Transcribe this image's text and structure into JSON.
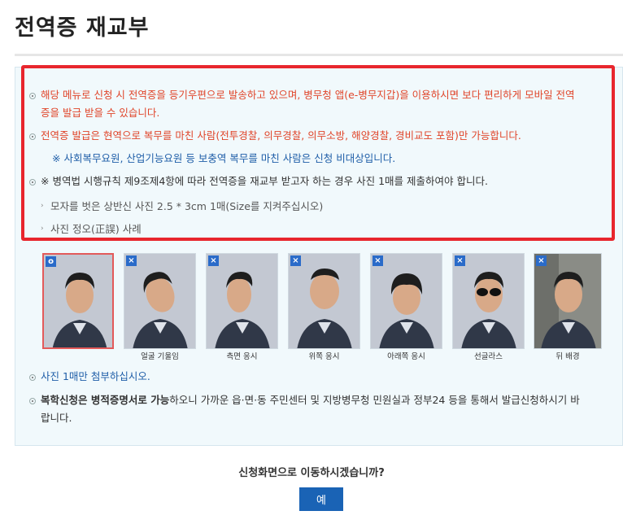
{
  "page": {
    "title": "전역증 재교부"
  },
  "notice": {
    "line1a": "해당 메뉴로 신청 시 전역증을 등기우편으로 발송하고 있으며, 병무청 앱(e-병무지갑)을 이용하시면 보다 편리하게 모바일 전역",
    "line1b": "증을 발급 받을 수 있습니다.",
    "line2": "전역증 발급은 현역으로 복무를 마친 사람(전투경찰, 의무경찰, 의무소방, 해양경찰, 경비교도 포함)만 가능합니다.",
    "line3": "※ 사회복무요원, 산업기능요원 등 보충역 복무를 마친 사람은 신청 비대상입니다.",
    "line4": "※ 병역법 시행규칙 제9조제4항에 따라 전역증을 재교부 받고자 하는 경우 사진 1매를 제출하여야 합니다.",
    "line5": "모자를 벗은 상반신 사진 2.5 * 3cm 1매(Size를 지켜주십시오)",
    "line6": "사진 정오(正誤) 사례"
  },
  "photos": [
    {
      "badge": "o",
      "caption": ""
    },
    {
      "badge": "×",
      "caption": "얼굴 기울임"
    },
    {
      "badge": "×",
      "caption": "측면 응시"
    },
    {
      "badge": "×",
      "caption": "위쪽 응시"
    },
    {
      "badge": "×",
      "caption": "아래쪽 응시"
    },
    {
      "badge": "×",
      "caption": "선글라스"
    },
    {
      "badge": "×",
      "caption": "뒤 배경"
    }
  ],
  "footer_notes": {
    "attach": "사진 1매만 첨부하십시오.",
    "reissue_bold": "복학신청은 병적증명서로 가능",
    "reissue_rest": "하오니 가까운 읍·면·동 주민센터 및 지방병무청 민원실과 정부24 등을 통해서 발급신청하시기 바",
    "reissue_tail": "랍니다."
  },
  "confirm": {
    "question": "신청화면으로 이동하시겠습니까?",
    "yes_label": "예"
  }
}
